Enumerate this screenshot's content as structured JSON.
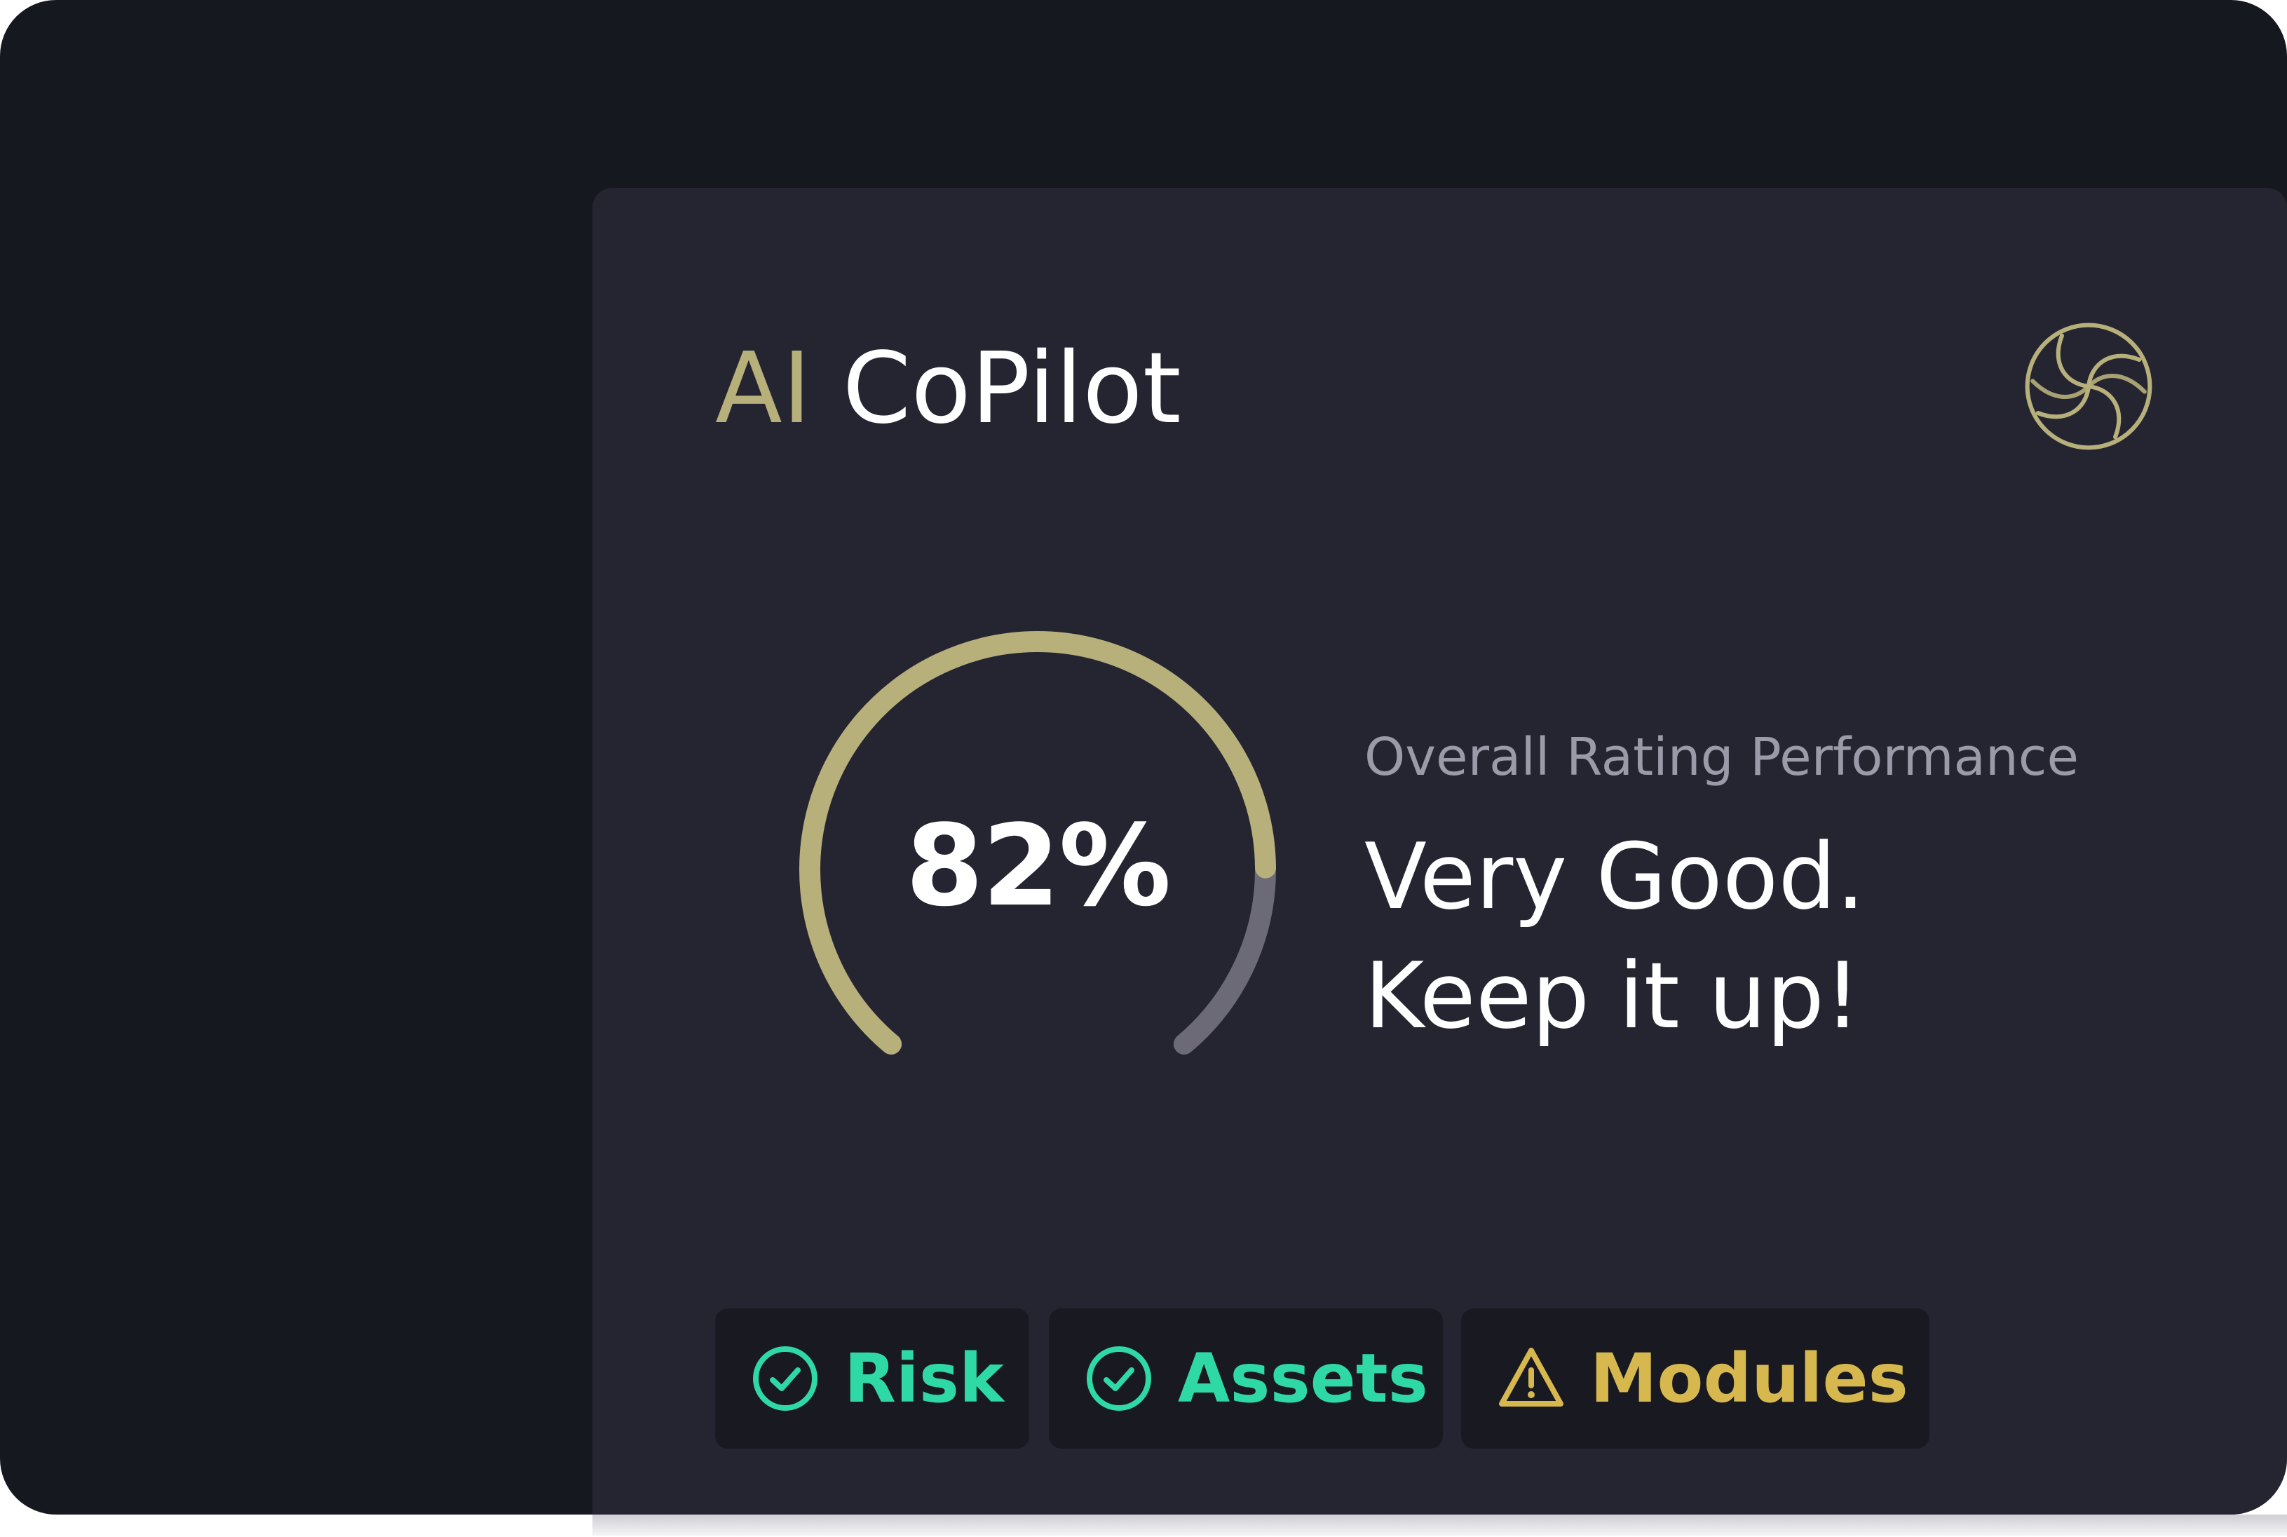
{
  "card": {
    "title_accent": "AI",
    "title_main": "CoPilot",
    "logo_icon": "swirl-logo-icon"
  },
  "rating": {
    "percent_text": "82%",
    "percent_value": 82,
    "label": "Overall Rating Performance",
    "message_line1": "Very Good.",
    "message_line2": "Keep it up!"
  },
  "chips": [
    {
      "label": "Risk",
      "icon": "check-circle-icon",
      "status": "ok"
    },
    {
      "label": "Assets",
      "icon": "check-circle-icon",
      "status": "ok"
    },
    {
      "label": "Modules",
      "icon": "warning-triangle-icon",
      "status": "warning"
    }
  ],
  "colors": {
    "background": "#161820",
    "card": "#252532",
    "accent_gold": "#b7b07a",
    "gauge_track": "#6b6a76",
    "ok_green": "#2fd9a5",
    "warning_yellow": "#d6b84e",
    "chip_background": "#191921"
  }
}
